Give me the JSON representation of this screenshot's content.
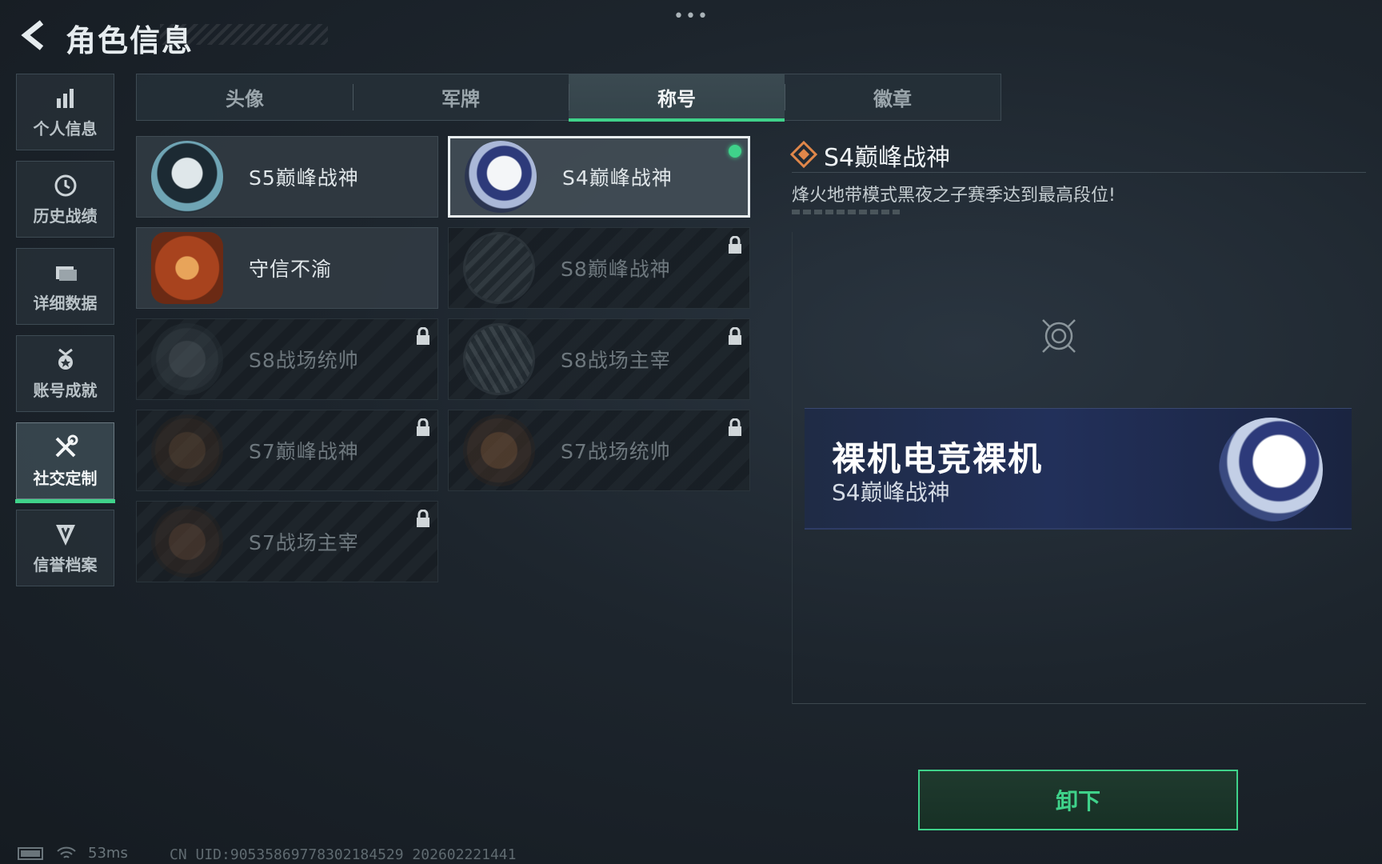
{
  "header": {
    "title": "角色信息",
    "more": "•••"
  },
  "sidebar": {
    "items": [
      {
        "label": "个人信息",
        "icon": "bar-chart-icon"
      },
      {
        "label": "历史战绩",
        "icon": "clock-icon"
      },
      {
        "label": "详细数据",
        "icon": "folder-icon"
      },
      {
        "label": "账号成就",
        "icon": "medal-icon"
      },
      {
        "label": "社交定制",
        "icon": "tools-icon",
        "active": true
      },
      {
        "label": "信誉档案",
        "icon": "shield-icon"
      }
    ]
  },
  "tabs": [
    {
      "label": "头像"
    },
    {
      "label": "军牌"
    },
    {
      "label": "称号",
      "active": true
    },
    {
      "label": "徽章"
    }
  ],
  "titles": [
    {
      "name": "S5巅峰战神",
      "locked": false,
      "icon": "diver-mask-emblem-icon"
    },
    {
      "name": "S4巅峰战神",
      "locked": false,
      "selected": true,
      "equipped": true,
      "icon": "night-vision-helmet-emblem-icon"
    },
    {
      "name": "守信不渝",
      "locked": false,
      "icon": "scales-emblem-icon"
    },
    {
      "name": "S8巅峰战神",
      "locked": true,
      "icon": "claw-emblem-icon"
    },
    {
      "name": "S8战场统帅",
      "locked": true,
      "icon": "tank-emblem-icon"
    },
    {
      "name": "S8战场主宰",
      "locked": true,
      "icon": "building-emblem-icon"
    },
    {
      "name": "S7巅峰战神",
      "locked": true,
      "icon": "rifle-emblem-icon"
    },
    {
      "name": "S7战场统帅",
      "locked": true,
      "icon": "gun-emblem-icon"
    },
    {
      "name": "S7战场主宰",
      "locked": true,
      "icon": "soldier-emblem-icon"
    }
  ],
  "detail": {
    "title": "S4巅峰战神",
    "description": "烽火地带模式黑夜之子赛季达到最高段位!",
    "nameplate": {
      "player_name": "裸机电竞裸机",
      "title": "S4巅峰战神"
    },
    "action_label": "卸下"
  },
  "footer": {
    "ping": "53ms",
    "uid": "CN UID:9053586977830218452​9 202602221441"
  },
  "colors": {
    "accent": "#3fd28a",
    "nameplate_bg": "#22305a"
  }
}
